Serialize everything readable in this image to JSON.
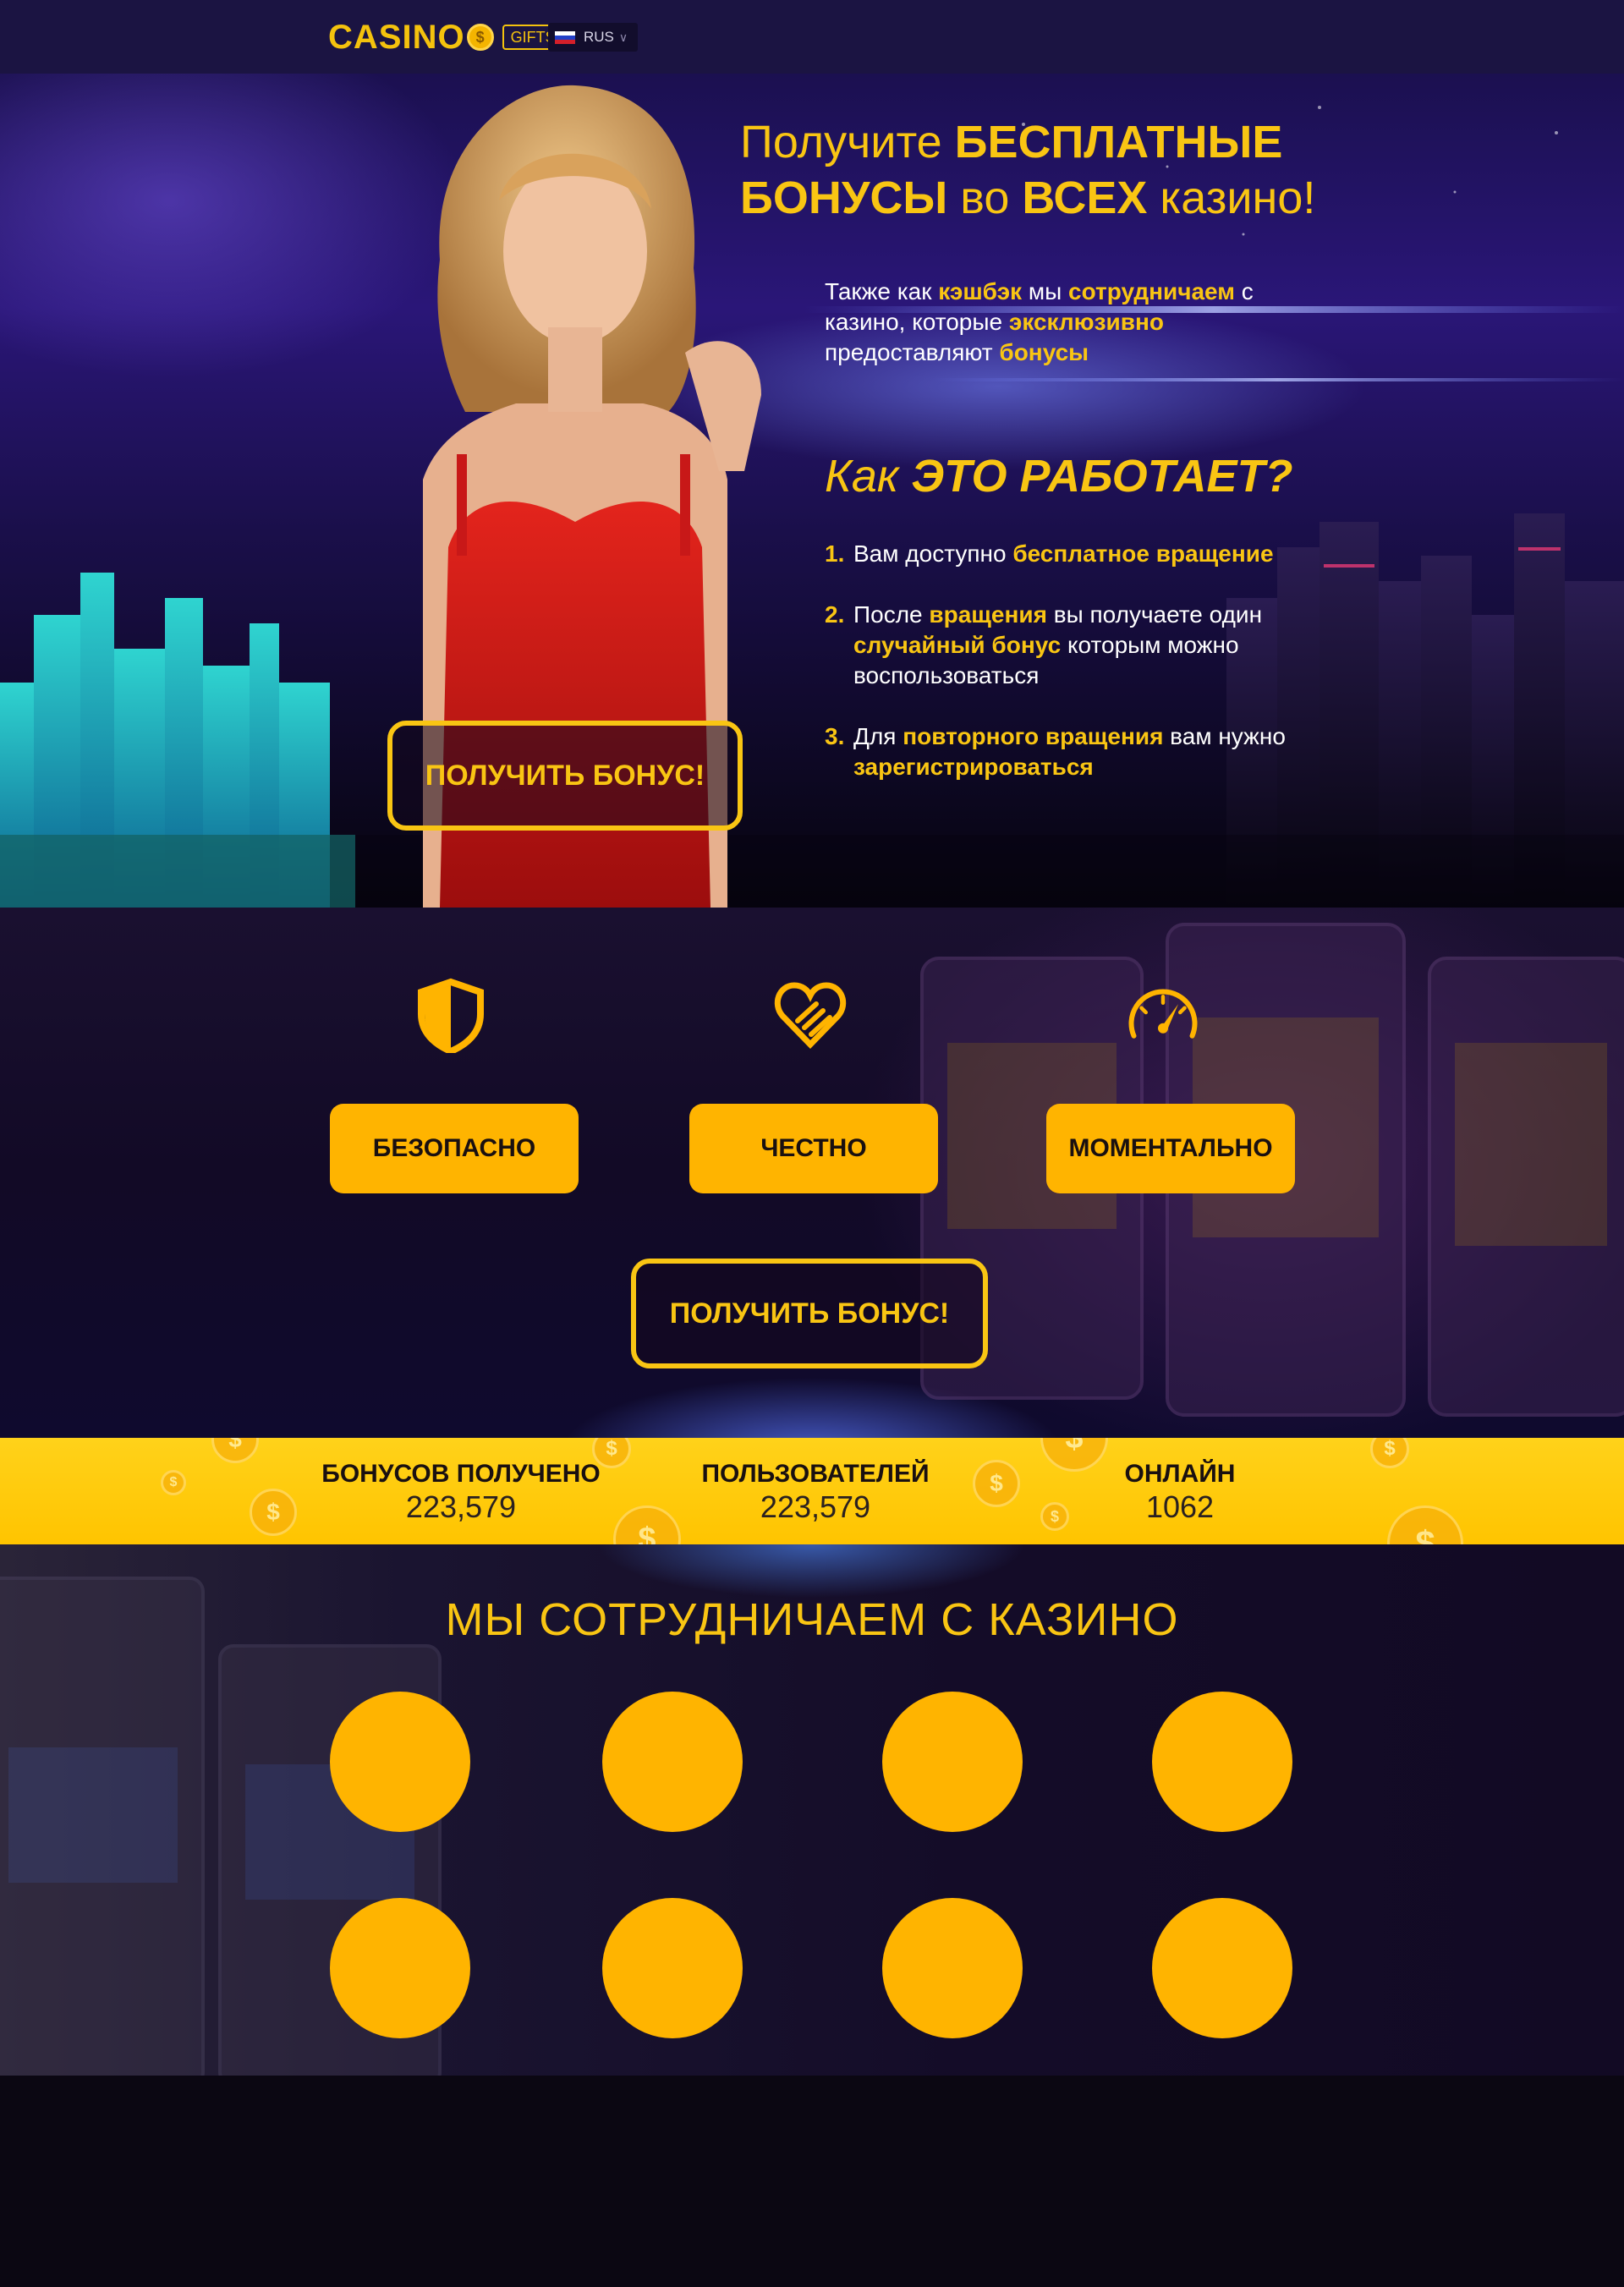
{
  "header": {
    "logo_text": "CASINO",
    "logo_coin": "$",
    "logo_badge": "GIFTS",
    "language": "RUS"
  },
  "hero": {
    "title_part1": "Получите ",
    "title_bold1": "БЕСПЛАТНЫЕ БОНУСЫ",
    "title_part2": " во ",
    "title_bold2": "ВСЕХ",
    "title_part3": " казино!",
    "desc_1": "Также как ",
    "desc_hl1": "кэшбэк",
    "desc_2": " мы ",
    "desc_hl2": "сотрудничаем",
    "desc_3": " с казино, которые ",
    "desc_hl3": "эксклюзивно",
    "desc_4": " предоставляют ",
    "desc_hl4": "бонусы",
    "how_title_1": "Как ",
    "how_title_bold": "ЭТО РАБОТАЕТ?",
    "steps": [
      {
        "num": "1.",
        "t1": "Вам доступно ",
        "h1": "бесплатное вращение",
        "t2": "",
        "h2": "",
        "t3": ""
      },
      {
        "num": "2.",
        "t1": "После ",
        "h1": "вращения",
        "t2": " вы получаете один ",
        "h2": "случайный бонус",
        "t3": " которым можно воспользоваться"
      },
      {
        "num": "3.",
        "t1": "Для ",
        "h1": "повторного вращения",
        "t2": " вам нужно ",
        "h2": "зарегистрироваться",
        "t3": ""
      }
    ],
    "cta_label": "ПОЛУЧИТЬ БОНУС!"
  },
  "features": {
    "items": [
      {
        "icon": "shield-icon",
        "label": "БЕЗОПАСНО"
      },
      {
        "icon": "heart-hand-icon",
        "label": "ЧЕСТНО"
      },
      {
        "icon": "speedometer-icon",
        "label": "МОМЕНТАЛЬНО"
      }
    ],
    "cta_label": "ПОЛУЧИТЬ БОНУС!"
  },
  "stats": {
    "items": [
      {
        "label": "БОНУСОВ ПОЛУЧЕНО",
        "value": "223,579"
      },
      {
        "label": "ПОЛЬЗОВАТЕЛЕЙ",
        "value": "223,579"
      },
      {
        "label": "ОНЛАЙН",
        "value": "1062"
      }
    ],
    "coin_symbol": "$"
  },
  "partners": {
    "title": "МЫ СОТРУДНИЧАЕМ С КАЗИНО"
  },
  "colors": {
    "accent": "#f9c513",
    "button": "#ffb400",
    "header_bg": "#1b1442"
  }
}
